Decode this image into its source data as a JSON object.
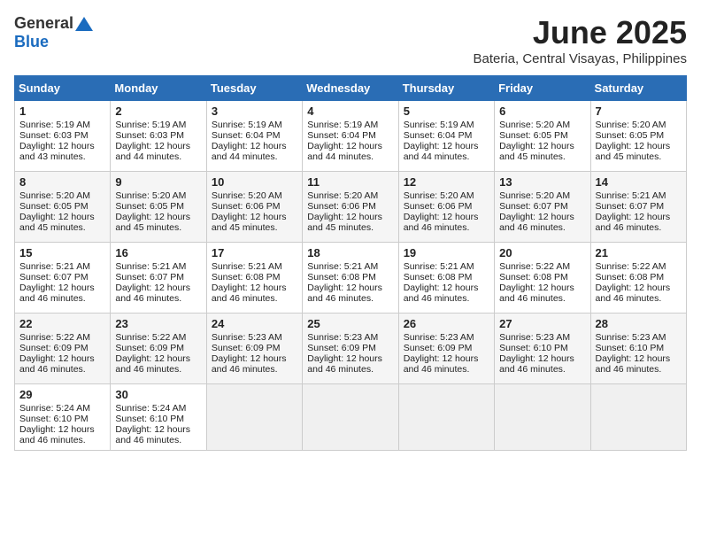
{
  "header": {
    "logo_general": "General",
    "logo_blue": "Blue",
    "month_title": "June 2025",
    "location": "Bateria, Central Visayas, Philippines"
  },
  "calendar": {
    "days_of_week": [
      "Sunday",
      "Monday",
      "Tuesday",
      "Wednesday",
      "Thursday",
      "Friday",
      "Saturday"
    ],
    "weeks": [
      [
        null,
        null,
        null,
        null,
        null,
        null,
        null
      ]
    ],
    "cells": [
      {
        "date": null,
        "content": ""
      },
      {
        "date": null,
        "content": ""
      },
      {
        "date": null,
        "content": ""
      },
      {
        "date": null,
        "content": ""
      },
      {
        "date": null,
        "content": ""
      },
      {
        "date": null,
        "content": ""
      },
      {
        "date": null,
        "content": ""
      }
    ],
    "rows": [
      [
        {
          "day": null
        },
        {
          "day": null
        },
        {
          "day": null
        },
        {
          "day": null
        },
        {
          "day": null
        },
        {
          "day": null
        },
        {
          "day": null
        }
      ]
    ]
  },
  "cells": {
    "d1": {
      "num": "1",
      "sunrise": "Sunrise: 5:19 AM",
      "sunset": "Sunset: 6:03 PM",
      "daylight": "Daylight: 12 hours and 43 minutes."
    },
    "d2": {
      "num": "2",
      "sunrise": "Sunrise: 5:19 AM",
      "sunset": "Sunset: 6:03 PM",
      "daylight": "Daylight: 12 hours and 44 minutes."
    },
    "d3": {
      "num": "3",
      "sunrise": "Sunrise: 5:19 AM",
      "sunset": "Sunset: 6:04 PM",
      "daylight": "Daylight: 12 hours and 44 minutes."
    },
    "d4": {
      "num": "4",
      "sunrise": "Sunrise: 5:19 AM",
      "sunset": "Sunset: 6:04 PM",
      "daylight": "Daylight: 12 hours and 44 minutes."
    },
    "d5": {
      "num": "5",
      "sunrise": "Sunrise: 5:19 AM",
      "sunset": "Sunset: 6:04 PM",
      "daylight": "Daylight: 12 hours and 44 minutes."
    },
    "d6": {
      "num": "6",
      "sunrise": "Sunrise: 5:20 AM",
      "sunset": "Sunset: 6:05 PM",
      "daylight": "Daylight: 12 hours and 45 minutes."
    },
    "d7": {
      "num": "7",
      "sunrise": "Sunrise: 5:20 AM",
      "sunset": "Sunset: 6:05 PM",
      "daylight": "Daylight: 12 hours and 45 minutes."
    },
    "d8": {
      "num": "8",
      "sunrise": "Sunrise: 5:20 AM",
      "sunset": "Sunset: 6:05 PM",
      "daylight": "Daylight: 12 hours and 45 minutes."
    },
    "d9": {
      "num": "9",
      "sunrise": "Sunrise: 5:20 AM",
      "sunset": "Sunset: 6:05 PM",
      "daylight": "Daylight: 12 hours and 45 minutes."
    },
    "d10": {
      "num": "10",
      "sunrise": "Sunrise: 5:20 AM",
      "sunset": "Sunset: 6:06 PM",
      "daylight": "Daylight: 12 hours and 45 minutes."
    },
    "d11": {
      "num": "11",
      "sunrise": "Sunrise: 5:20 AM",
      "sunset": "Sunset: 6:06 PM",
      "daylight": "Daylight: 12 hours and 45 minutes."
    },
    "d12": {
      "num": "12",
      "sunrise": "Sunrise: 5:20 AM",
      "sunset": "Sunset: 6:06 PM",
      "daylight": "Daylight: 12 hours and 46 minutes."
    },
    "d13": {
      "num": "13",
      "sunrise": "Sunrise: 5:20 AM",
      "sunset": "Sunset: 6:07 PM",
      "daylight": "Daylight: 12 hours and 46 minutes."
    },
    "d14": {
      "num": "14",
      "sunrise": "Sunrise: 5:21 AM",
      "sunset": "Sunset: 6:07 PM",
      "daylight": "Daylight: 12 hours and 46 minutes."
    },
    "d15": {
      "num": "15",
      "sunrise": "Sunrise: 5:21 AM",
      "sunset": "Sunset: 6:07 PM",
      "daylight": "Daylight: 12 hours and 46 minutes."
    },
    "d16": {
      "num": "16",
      "sunrise": "Sunrise: 5:21 AM",
      "sunset": "Sunset: 6:07 PM",
      "daylight": "Daylight: 12 hours and 46 minutes."
    },
    "d17": {
      "num": "17",
      "sunrise": "Sunrise: 5:21 AM",
      "sunset": "Sunset: 6:08 PM",
      "daylight": "Daylight: 12 hours and 46 minutes."
    },
    "d18": {
      "num": "18",
      "sunrise": "Sunrise: 5:21 AM",
      "sunset": "Sunset: 6:08 PM",
      "daylight": "Daylight: 12 hours and 46 minutes."
    },
    "d19": {
      "num": "19",
      "sunrise": "Sunrise: 5:21 AM",
      "sunset": "Sunset: 6:08 PM",
      "daylight": "Daylight: 12 hours and 46 minutes."
    },
    "d20": {
      "num": "20",
      "sunrise": "Sunrise: 5:22 AM",
      "sunset": "Sunset: 6:08 PM",
      "daylight": "Daylight: 12 hours and 46 minutes."
    },
    "d21": {
      "num": "21",
      "sunrise": "Sunrise: 5:22 AM",
      "sunset": "Sunset: 6:08 PM",
      "daylight": "Daylight: 12 hours and 46 minutes."
    },
    "d22": {
      "num": "22",
      "sunrise": "Sunrise: 5:22 AM",
      "sunset": "Sunset: 6:09 PM",
      "daylight": "Daylight: 12 hours and 46 minutes."
    },
    "d23": {
      "num": "23",
      "sunrise": "Sunrise: 5:22 AM",
      "sunset": "Sunset: 6:09 PM",
      "daylight": "Daylight: 12 hours and 46 minutes."
    },
    "d24": {
      "num": "24",
      "sunrise": "Sunrise: 5:23 AM",
      "sunset": "Sunset: 6:09 PM",
      "daylight": "Daylight: 12 hours and 46 minutes."
    },
    "d25": {
      "num": "25",
      "sunrise": "Sunrise: 5:23 AM",
      "sunset": "Sunset: 6:09 PM",
      "daylight": "Daylight: 12 hours and 46 minutes."
    },
    "d26": {
      "num": "26",
      "sunrise": "Sunrise: 5:23 AM",
      "sunset": "Sunset: 6:09 PM",
      "daylight": "Daylight: 12 hours and 46 minutes."
    },
    "d27": {
      "num": "27",
      "sunrise": "Sunrise: 5:23 AM",
      "sunset": "Sunset: 6:10 PM",
      "daylight": "Daylight: 12 hours and 46 minutes."
    },
    "d28": {
      "num": "28",
      "sunrise": "Sunrise: 5:23 AM",
      "sunset": "Sunset: 6:10 PM",
      "daylight": "Daylight: 12 hours and 46 minutes."
    },
    "d29": {
      "num": "29",
      "sunrise": "Sunrise: 5:24 AM",
      "sunset": "Sunset: 6:10 PM",
      "daylight": "Daylight: 12 hours and 46 minutes."
    },
    "d30": {
      "num": "30",
      "sunrise": "Sunrise: 5:24 AM",
      "sunset": "Sunset: 6:10 PM",
      "daylight": "Daylight: 12 hours and 46 minutes."
    }
  }
}
